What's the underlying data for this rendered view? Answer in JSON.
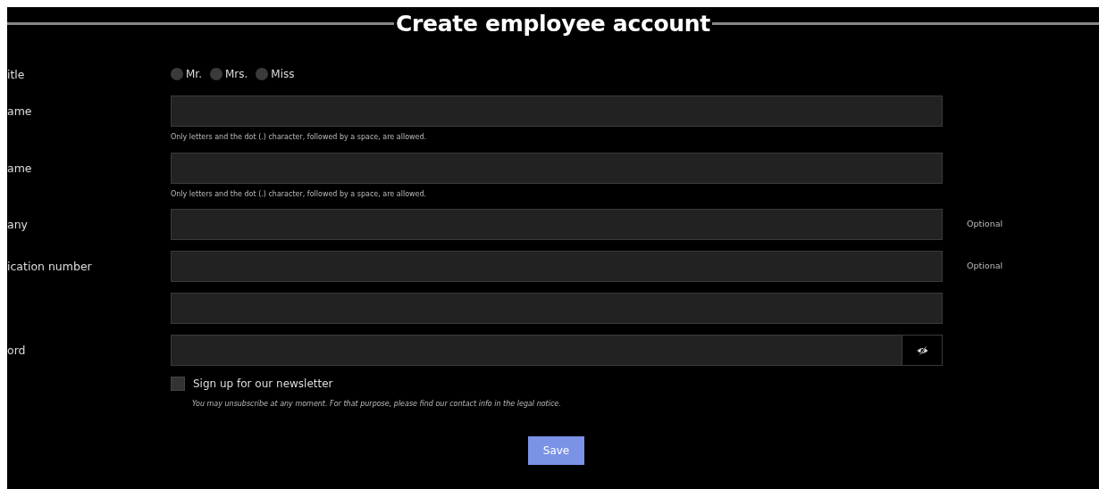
{
  "title": "Create employee account",
  "radio_row": {
    "label": "itle",
    "options": [
      {
        "label": "Mr.",
        "selected": false
      },
      {
        "label": "Mrs.",
        "selected": false
      },
      {
        "label": "Miss",
        "selected": false
      }
    ]
  },
  "fields": [
    {
      "kind": "text",
      "label": "ame",
      "hint": "Only letters and the dot (.) character, followed by a space, are allowed."
    },
    {
      "kind": "text",
      "label": "ame",
      "hint": "Only letters and the dot (.) character, followed by a space, are allowed."
    },
    {
      "kind": "text",
      "label": "any",
      "note": "Optional"
    },
    {
      "kind": "text",
      "label": "ication number",
      "note": "Optional"
    },
    {
      "kind": "text"
    },
    {
      "kind": "password",
      "label": "ord"
    }
  ],
  "newsletter": {
    "label": "Sign up for our newsletter",
    "checked": false,
    "note": "You may unsubscribe at any moment. For that purpose, please find our contact info in the legal notice."
  },
  "save_button": "Save"
}
